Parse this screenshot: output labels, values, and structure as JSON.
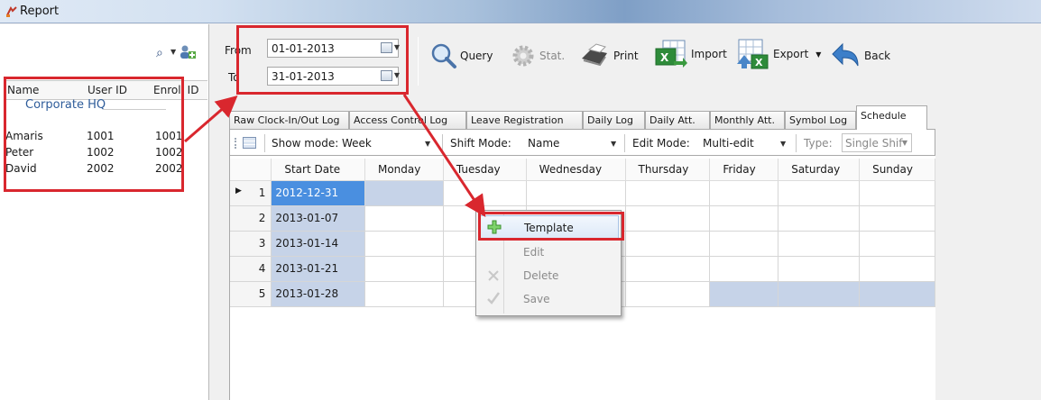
{
  "window": {
    "title": "Report"
  },
  "employees": {
    "columns": [
      "Name",
      "User ID",
      "Enroll ID"
    ],
    "group": "Corporate HQ",
    "rows": [
      {
        "name": "Amaris",
        "user_id": "1001",
        "enroll_id": "1001"
      },
      {
        "name": "Peter",
        "user_id": "1002",
        "enroll_id": "1002"
      },
      {
        "name": "David",
        "user_id": "2002",
        "enroll_id": "2002"
      }
    ]
  },
  "dates": {
    "from_label": "From",
    "from_value": "01-01-2013",
    "to_label": "To",
    "to_value": "31-01-2013"
  },
  "toolbar": {
    "query": "Query",
    "stat": "Stat.",
    "print": "Print",
    "import": "Import",
    "export": "Export",
    "back": "Back"
  },
  "tabs": [
    "Raw Clock-In/Out Log",
    "Access Control Log",
    "Leave Registration",
    "Daily Log",
    "Daily Att.",
    "Monthly Att.",
    "Symbol Log",
    "Schedule"
  ],
  "filters": {
    "show_mode_label": "Show mode:",
    "show_mode_value": "Week",
    "shift_mode_label": "Shift Mode:",
    "shift_mode_value": "Name",
    "edit_mode_label": "Edit Mode:",
    "edit_mode_value": "Multi-edit",
    "type_label": "Type:",
    "type_value": "Single Shif"
  },
  "schedule": {
    "columns": [
      "Start Date",
      "Monday",
      "Tuesday",
      "Wednesday",
      "Thursday",
      "Friday",
      "Saturday",
      "Sunday"
    ],
    "rows": [
      {
        "num": "1",
        "start": "2012-12-31"
      },
      {
        "num": "2",
        "start": "2013-01-07"
      },
      {
        "num": "3",
        "start": "2013-01-14"
      },
      {
        "num": "4",
        "start": "2013-01-21"
      },
      {
        "num": "5",
        "start": "2013-01-28"
      }
    ]
  },
  "context_menu": {
    "template": "Template",
    "edit": "Edit",
    "delete": "Delete",
    "save": "Save"
  },
  "colors": {
    "annotation_red": "#d9272e",
    "selected_cell": "#4a8fe0",
    "date_cell": "#c6d3e8",
    "group_text": "#2e5c9a"
  }
}
